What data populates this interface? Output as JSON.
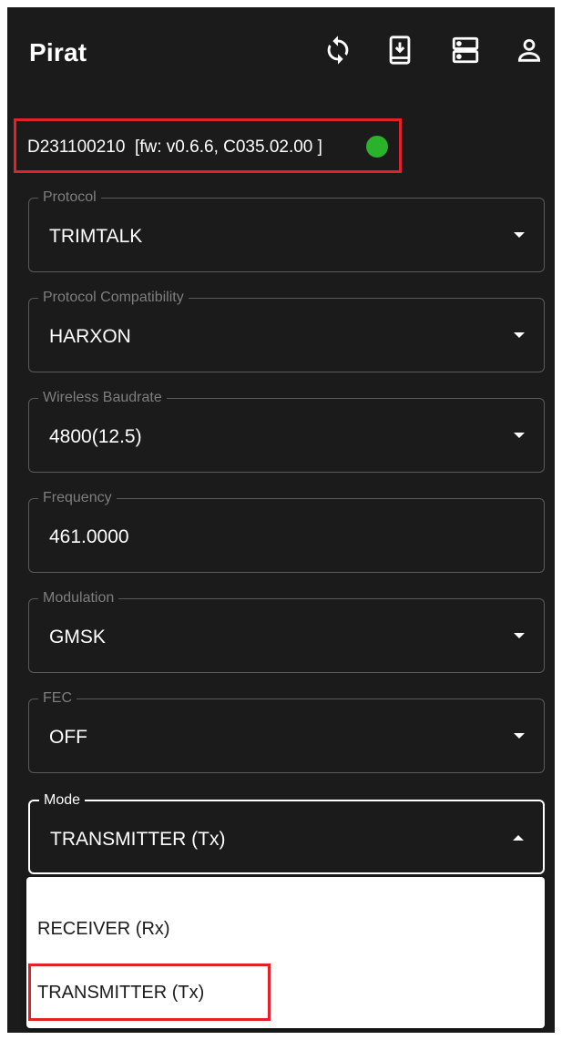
{
  "app": {
    "title": "Pirat",
    "toolbar": {
      "icons": [
        "refresh-icon",
        "download-device-icon",
        "storage-icon",
        "account-icon"
      ]
    }
  },
  "device": {
    "info": "D231100210  [fw: v0.6.6, C035.02.00 ]",
    "status_color": "#2bb22b"
  },
  "fields": {
    "protocol": {
      "label": "Protocol",
      "value": "TRIMTALK"
    },
    "protocol_compat": {
      "label": "Protocol Compatibility",
      "value": "HARXON"
    },
    "wireless_baudrate": {
      "label": "Wireless Baudrate",
      "value": "4800(12.5)"
    },
    "frequency": {
      "label": "Frequency",
      "value": "461.0000"
    },
    "modulation": {
      "label": "Modulation",
      "value": "GMSK"
    },
    "fec": {
      "label": "FEC",
      "value": "OFF"
    },
    "mode": {
      "label": "Mode",
      "value": "TRANSMITTER (Tx)"
    }
  },
  "mode_options": [
    "RECEIVER (Rx)",
    "TRANSMITTER (Tx)"
  ],
  "colors": {
    "background": "#1b1b1b",
    "highlight_red": "#e0222b",
    "status_green": "#2bb22b"
  }
}
